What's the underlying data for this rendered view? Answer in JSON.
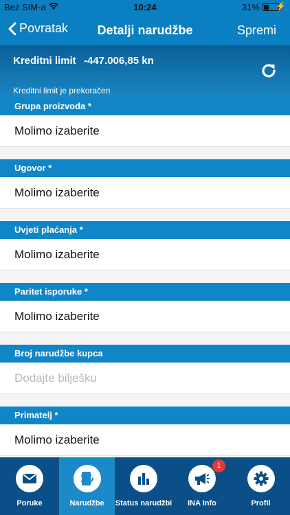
{
  "status_bar": {
    "carrier": "Bez SIM-a",
    "time": "10:24",
    "battery": "31%"
  },
  "nav": {
    "back_label": "Povratak",
    "title": "Detalji narudžbe",
    "save_label": "Spremi"
  },
  "credit": {
    "label": "Kreditni limit",
    "value": "-447.006,85 kn",
    "warning": "Kreditni limit je prekoračen"
  },
  "form": {
    "product_group": {
      "label": "Grupa proizvoda *",
      "value": "Molimo izaberite"
    },
    "contract": {
      "label": "Ugovor *",
      "value": "Molimo izaberite"
    },
    "payment_terms": {
      "label": "Uvjeti plaćanja *",
      "value": "Molimo izaberite"
    },
    "delivery_parity": {
      "label": "Paritet isporuke *",
      "value": "Molimo izaberite"
    },
    "customer_order_number": {
      "label": "Broj narudžbe kupca",
      "placeholder": "Dodajte bilješku"
    },
    "recipient": {
      "label": "Primatelj *",
      "value": "Molimo izaberite"
    }
  },
  "tabs": [
    {
      "label": "Poruke",
      "icon": "envelope-icon"
    },
    {
      "label": "Narudžbe",
      "icon": "fuel-barrel-icon",
      "active": true
    },
    {
      "label": "Status narudžbi",
      "icon": "bar-chart-icon"
    },
    {
      "label": "INA Info",
      "icon": "megaphone-icon",
      "badge": "1"
    },
    {
      "label": "Profil",
      "icon": "gear-icon"
    }
  ],
  "colors": {
    "primary": "#0a7fc2",
    "section": "#1186c7",
    "tabbar": "#0a4f87",
    "tab_active": "#1c8ac8",
    "badge": "#e53935"
  }
}
